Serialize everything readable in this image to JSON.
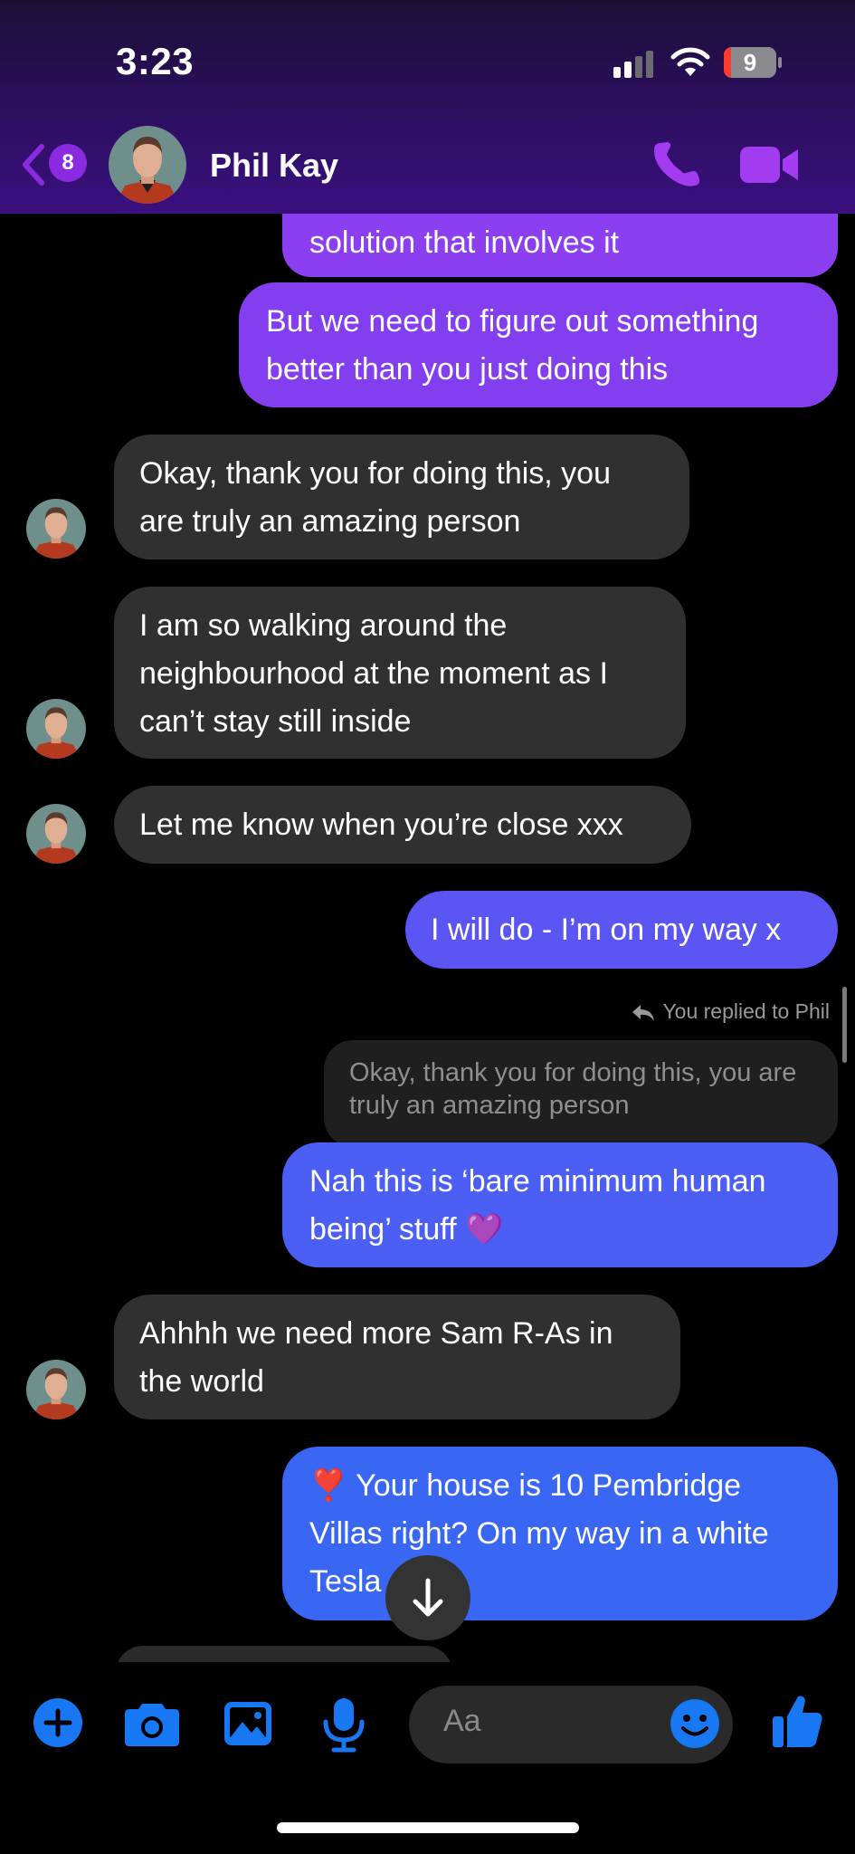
{
  "status_bar": {
    "time": "3:23",
    "battery": "9"
  },
  "header": {
    "unread_count": "8",
    "contact_name": "Phil Kay"
  },
  "messages": [
    {
      "side": "out",
      "text": "solution that involves it"
    },
    {
      "side": "out",
      "text": "But we need to figure out something better than you just doing this"
    },
    {
      "side": "in",
      "text": "Okay, thank you for doing this, you are truly an amazing person"
    },
    {
      "side": "in",
      "text": "I am so walking around the neighbourhood at the moment as I can’t stay still inside"
    },
    {
      "side": "in",
      "text": "Let me know when you’re close xxx"
    },
    {
      "side": "out",
      "text": "I will do - I’m on my way x"
    },
    {
      "side": "out",
      "text": "Nah this is ‘bare minimum human being’ stuff 💜"
    },
    {
      "side": "in",
      "text": "Ahhhh we need more Sam R-As in the world"
    },
    {
      "side": "out",
      "text": "❣️ Your house is 10 Pembridge Villas right? On my way in a white Tesla"
    }
  ],
  "reply": {
    "label": "You replied to Phil",
    "quoted_text": "Okay, thank you for doing this, you are truly an amazing person"
  },
  "composer": {
    "placeholder": "Aa"
  },
  "colors": {
    "accent": "#8a2be2",
    "incoming_bubble": "#303030",
    "outgoing_purple": "#8b3ff0",
    "outgoing_blue": "#3a66f4",
    "composer_icons": "#1877f2"
  }
}
